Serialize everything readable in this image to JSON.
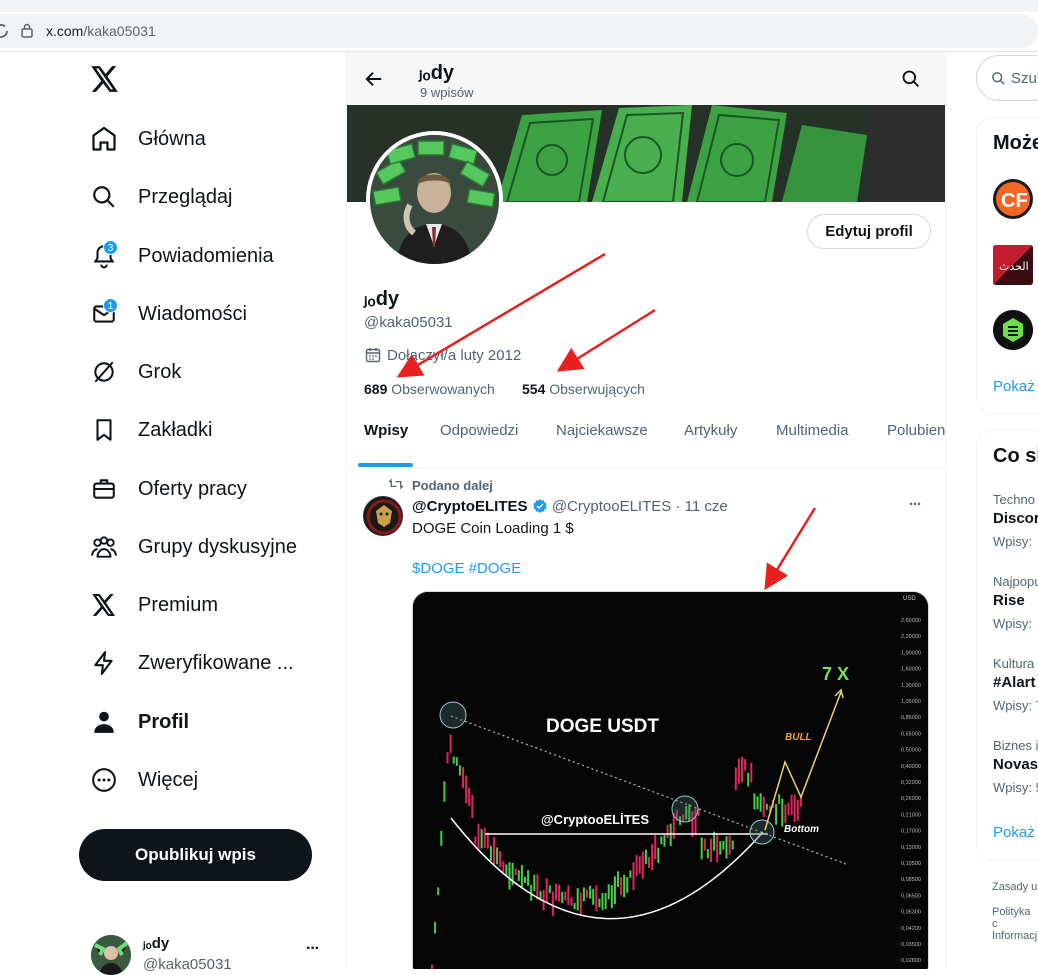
{
  "browser": {
    "url_domain": "x.com",
    "url_path": "/kaka05031"
  },
  "nav": {
    "items": [
      {
        "label": "Główna",
        "bold": false
      },
      {
        "label": "Przeglądaj",
        "bold": false
      },
      {
        "label": "Powiadomienia",
        "bold": false,
        "badge": "3"
      },
      {
        "label": "Wiadomości",
        "bold": false,
        "badge": "1"
      },
      {
        "label": "Grok",
        "bold": false
      },
      {
        "label": "Zakładki",
        "bold": false
      },
      {
        "label": "Oferty pracy",
        "bold": false
      },
      {
        "label": "Grupy dyskusyjne",
        "bold": false
      },
      {
        "label": "Premium",
        "bold": false
      },
      {
        "label": "Zweryfikowane ...",
        "bold": false
      },
      {
        "label": "Profil",
        "bold": true
      },
      {
        "label": "Więcej",
        "bold": false
      }
    ],
    "publish_label": "Opublikuj wpis",
    "account_name": "ⱼₒdy",
    "account_handle": "@kaka05031",
    "more": "···"
  },
  "header": {
    "name": "ⱼₒdy",
    "posts": "9 wpisów"
  },
  "profile": {
    "edit_label": "Edytuj profil",
    "name": "ⱼₒdy",
    "handle": "@kaka05031",
    "joined": "Dołączył/a luty 2012",
    "following_count": "689",
    "following_label": "Obserwowanych",
    "followers_count": "554",
    "followers_label": "Obserwujących"
  },
  "tabs": [
    "Wpisy",
    "Odpowiedzi",
    "Najciekawsze",
    "Artykuły",
    "Multimedia",
    "Polubien"
  ],
  "post": {
    "repost_label": "Podano dalej",
    "author_name": "@CryptoELITES",
    "author_handle": "@CryptooELITES",
    "sep": "·",
    "time": "11 cze",
    "text": "DOGE Coin Loading 1 $",
    "hashtags": "$DOGE #DOGE",
    "more": "···",
    "chart": {
      "title": "DOGE USDT",
      "watermark": "@CryptooELİTES",
      "target": "7 X",
      "bull": "BULL",
      "bottom": "Bottom",
      "axis_unit": "USD",
      "axis_ticks": [
        "2,60000",
        "2,20000",
        "1,90000",
        "1,60000",
        "1,30000",
        "1,05000",
        "0,85000",
        "0,65000",
        "0,50000",
        "0,40000",
        "0,32000",
        "0,26000",
        "0,21000",
        "0,17000",
        "0,13000",
        "0,10500",
        "0,08500",
        "0,06500",
        "0,05300",
        "0,04200",
        "0,03500",
        "0,02800"
      ]
    }
  },
  "right": {
    "search_placeholder": "Szuk",
    "who_title": "Może",
    "who_show": "Pokaż",
    "trends_title": "Co si",
    "trends": [
      {
        "category": "Techno",
        "name": "Discor",
        "count": "Wpisy: "
      },
      {
        "category": "Najpopu",
        "name": "Rise",
        "count": "Wpisy: "
      },
      {
        "category": "Kultura",
        "name": "#Alart",
        "count": "Wpisy: 7"
      },
      {
        "category": "Biznes i",
        "name": "Novas",
        "count": "Wpisy: 5"
      }
    ],
    "trends_show": "Pokaż",
    "footer": [
      "Zasady u",
      "Polityka c",
      "Informacj"
    ]
  }
}
